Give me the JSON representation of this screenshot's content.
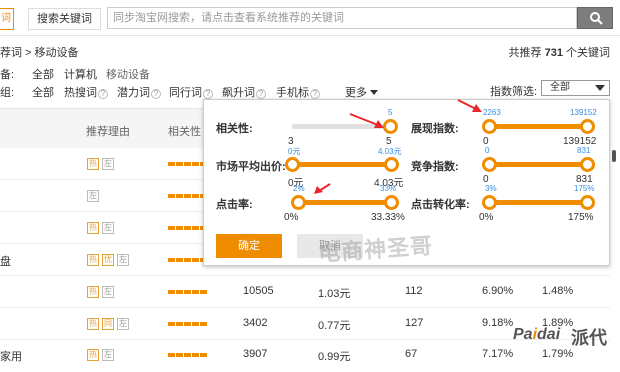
{
  "topbar": {
    "active_tab": "词",
    "tab": "搜索关键词",
    "search_placeholder": "同步淘宝网搜索，请点击查看系统推荐的关键词",
    "search_icon": "search-icon"
  },
  "breadcrumb": {
    "text": "荐词 >  移动设备"
  },
  "total": {
    "prefix": "共推荐",
    "count": "731",
    "suffix": "个关键词"
  },
  "filters": {
    "row1_label": "备:",
    "row1_options": [
      "全部",
      "计算机",
      "移动设备"
    ],
    "row2_label": "组:",
    "row2_options": [
      "全部",
      "热搜词",
      "潜力词",
      "同行词",
      "飙升词",
      "手机标"
    ],
    "more": "更多",
    "index_filter_label": "指数筛选:",
    "index_filter_value": "全部"
  },
  "table": {
    "headers": [
      "推荐理由",
      "相关性"
    ],
    "rows": [
      {
        "tags": [
          "热",
          "左"
        ]
      },
      {
        "tags": [
          "左"
        ]
      },
      {
        "tags": [
          "热",
          "左"
        ]
      },
      {
        "left": "盘",
        "tags": [
          "热",
          "优",
          "左"
        ]
      },
      {
        "tags": [
          "热",
          "左"
        ],
        "cols": [
          "10505",
          "1.03元",
          "112",
          "6.90%",
          "1.48%"
        ]
      },
      {
        "tags": [
          "热",
          "同",
          "左"
        ],
        "cols": [
          "3402",
          "0.77元",
          "127",
          "9.18%",
          "1.89%"
        ]
      },
      {
        "left": "家用",
        "tags": [
          "热",
          "左"
        ],
        "cols": [
          "3907",
          "0.99元",
          "67",
          "7.17%",
          "1.79%"
        ]
      }
    ]
  },
  "popup": {
    "sliders": [
      {
        "label": "相关性:",
        "top": "5",
        "min": "3",
        "max": "5",
        "bot_right": "5",
        "fraction": 1.0
      },
      {
        "label": "展现指数:",
        "top_left": "2263",
        "top_right": "139152",
        "min": "0",
        "max": "139152"
      },
      {
        "label": "市场平均出价:",
        "top_left": "0元",
        "top_right": "4.03元",
        "min": "0元",
        "max": "4.03元"
      },
      {
        "label": "竞争指数:",
        "top_left": "0",
        "top_right": "831",
        "min": "0",
        "max": "831"
      },
      {
        "label": "点击率:",
        "top_left": "2%",
        "top_right": "33%",
        "min": "0%",
        "max": "33.33%"
      },
      {
        "label": "点击转化率:",
        "top_left": "3%",
        "top_right": "175%",
        "min": "0%",
        "max": "175%"
      }
    ],
    "ok": "确定",
    "cancel": "取消"
  },
  "watermark": {
    "text": "电商神圣哥",
    "logo_latin_a": "Pa",
    "logo_latin_i": "i",
    "logo_latin_b": "dai",
    "logo_cjk": "派代"
  },
  "colors": {
    "accent": "#f08c00",
    "link_blue": "#3a8ee6",
    "arrow_red": "#e8272b"
  }
}
